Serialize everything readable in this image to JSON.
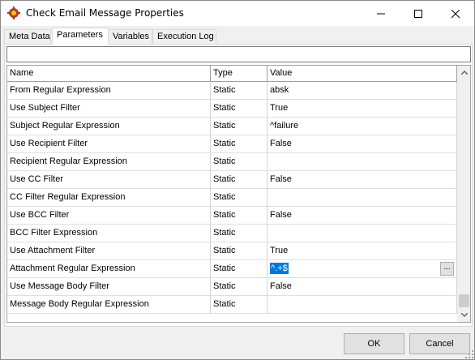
{
  "window": {
    "title": "Check Email Message Properties",
    "icon": "gear-app-icon"
  },
  "tabs": [
    {
      "label": "Meta Data",
      "active": false
    },
    {
      "label": "Parameters",
      "active": true
    },
    {
      "label": "Variables",
      "active": false
    },
    {
      "label": "Execution Log",
      "active": false
    }
  ],
  "filter": {
    "value": "",
    "placeholder": ""
  },
  "grid": {
    "headers": {
      "name": "Name",
      "type": "Type",
      "value": "Value"
    },
    "rows": [
      {
        "name": "From Regular Expression",
        "type": "Static",
        "value": "absk"
      },
      {
        "name": "Use Subject Filter",
        "type": "Static",
        "value": "True"
      },
      {
        "name": "Subject Regular Expression",
        "type": "Static",
        "value": "^failure"
      },
      {
        "name": "Use Recipient Filter",
        "type": "Static",
        "value": "False"
      },
      {
        "name": "Recipient Regular Expression",
        "type": "Static",
        "value": ""
      },
      {
        "name": "Use CC Filter",
        "type": "Static",
        "value": "False"
      },
      {
        "name": "CC Filter Regular Expression",
        "type": "Static",
        "value": ""
      },
      {
        "name": "Use BCC Filter",
        "type": "Static",
        "value": "False"
      },
      {
        "name": "BCC Filter Expression",
        "type": "Static",
        "value": ""
      },
      {
        "name": "Use Attachment Filter",
        "type": "Static",
        "value": "True"
      },
      {
        "name": "Attachment Regular Expression",
        "type": "Static",
        "value": "^.+$",
        "selected": true,
        "ellipsis": "..."
      },
      {
        "name": "Use Message Body Filter",
        "type": "Static",
        "value": "False"
      },
      {
        "name": "Message Body Regular Expression",
        "type": "Static",
        "value": ""
      }
    ]
  },
  "buttons": {
    "ok": "OK",
    "cancel": "Cancel"
  },
  "colors": {
    "selection": "#0078d7"
  }
}
